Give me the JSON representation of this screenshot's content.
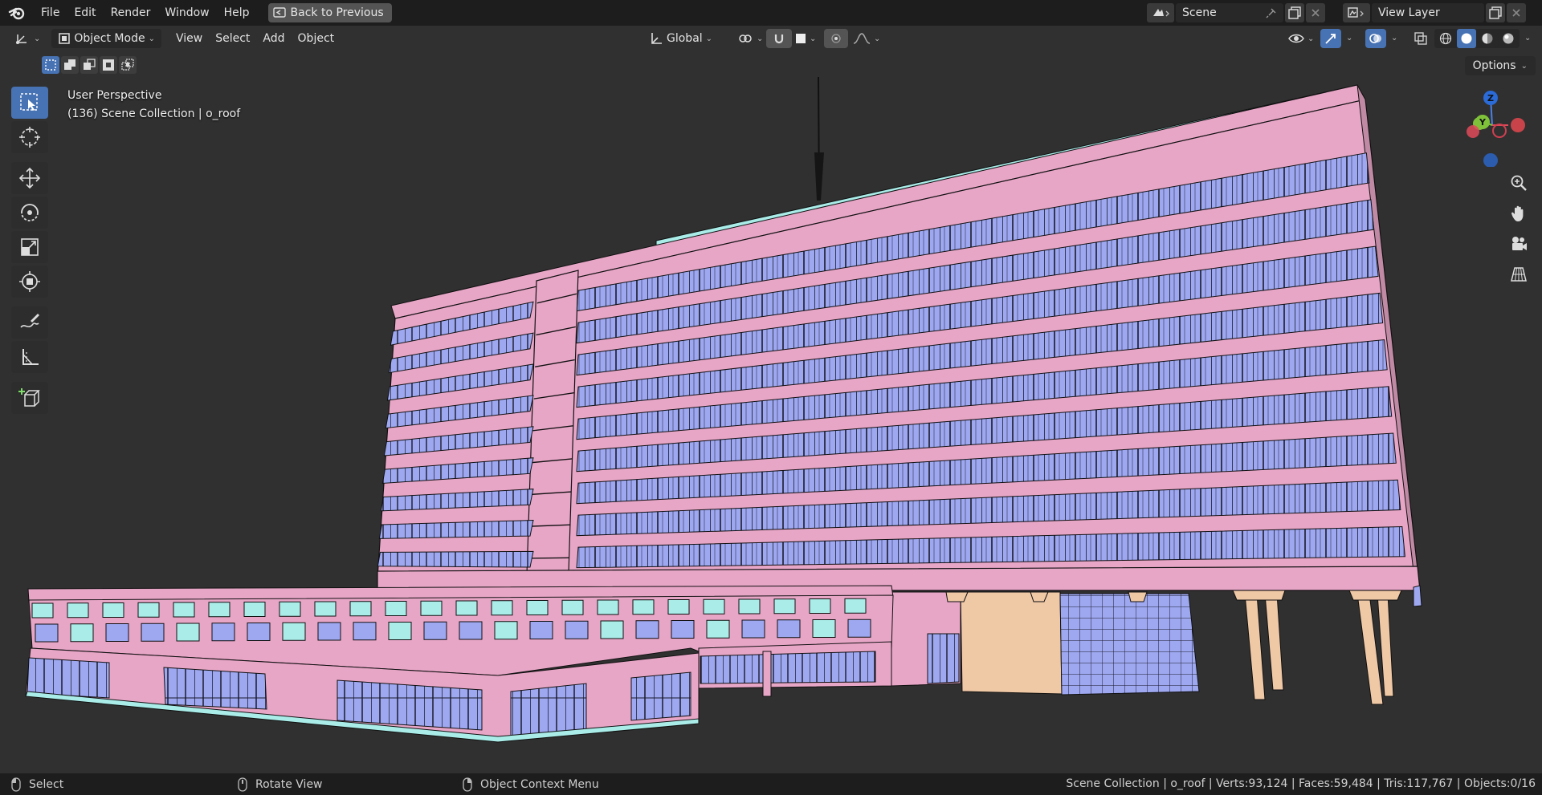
{
  "topbar": {
    "menu": [
      "File",
      "Edit",
      "Render",
      "Window",
      "Help"
    ],
    "back_button": "Back to Previous",
    "scene": "Scene",
    "view_layer": "View Layer"
  },
  "header": {
    "mode": "Object Mode",
    "menus": [
      "View",
      "Select",
      "Add",
      "Object"
    ],
    "orientation": "Global",
    "options": "Options"
  },
  "viewport": {
    "perspective": "User Perspective",
    "collection": "(136) Scene Collection | o_roof",
    "gizmo_axes": [
      "Z",
      "Y"
    ]
  },
  "statusbar": {
    "select": "Select",
    "rotate": "Rotate View",
    "context": "Object Context Menu",
    "stats": "Scene Collection | o_roof | Verts:93,124 | Faces:59,484 | Tris:117,767 | Objects:0/16"
  },
  "colors": {
    "facade": "#e8a6c7",
    "glass": "#9ea8f0",
    "cyan": "#a9ece8",
    "pillar": "#efc8a6",
    "accent": "#4772b3"
  }
}
